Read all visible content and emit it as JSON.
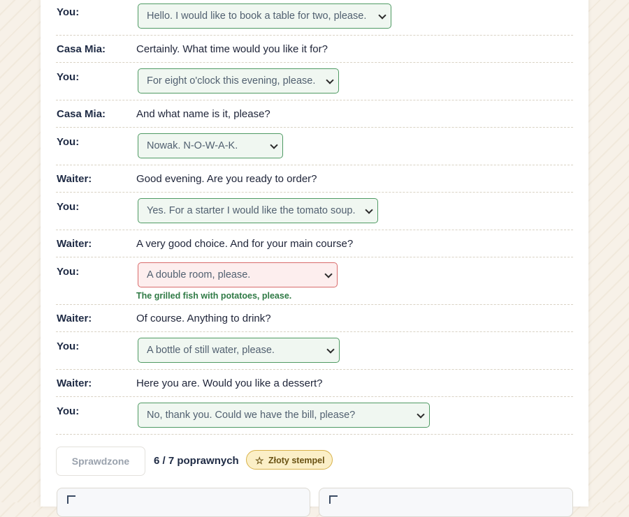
{
  "dialogue": [
    {
      "speaker": "You:",
      "select": "Hello. I would like to book a table for two, please."
    },
    {
      "speaker": "Casa Mia:",
      "text": "Certainly. What time would you like it for?"
    },
    {
      "speaker": "You:",
      "select": "For eight o'clock this evening, please."
    },
    {
      "speaker": "Casa Mia:",
      "text": "And what name is it, please?"
    },
    {
      "speaker": "You:",
      "select": "Nowak. N-O-W-A-K."
    },
    {
      "speaker": "Waiter:",
      "text": "Good evening. Are you ready to order?"
    },
    {
      "speaker": "You:",
      "select": "Yes. For a starter I would like the tomato soup."
    },
    {
      "speaker": "Waiter:",
      "text": "A very good choice. And for your main course?"
    },
    {
      "speaker": "You:",
      "select": "A double room, please.",
      "feedback": "The grilled fish with potatoes, please."
    },
    {
      "speaker": "Waiter:",
      "text": "Of course. Anything to drink?"
    },
    {
      "speaker": "You:",
      "select": "A bottle of still water, please."
    },
    {
      "speaker": "Waiter:",
      "text": "Here you are. Would you like a dessert?"
    },
    {
      "speaker": "You:",
      "select": "No, thank you. Could we have the bill, please?"
    }
  ],
  "footer": {
    "checked_label": "Sprawdzone",
    "score": "6 / 7 poprawnych",
    "badge_label": "Złoty stempel",
    "badge_icon": "star-outline-icon"
  },
  "colors": {
    "correct_border": "#4f9a63",
    "wrong_border": "#d96b6b",
    "feedback_text": "#2f7a45",
    "badge_bg": "#fbefc7"
  }
}
